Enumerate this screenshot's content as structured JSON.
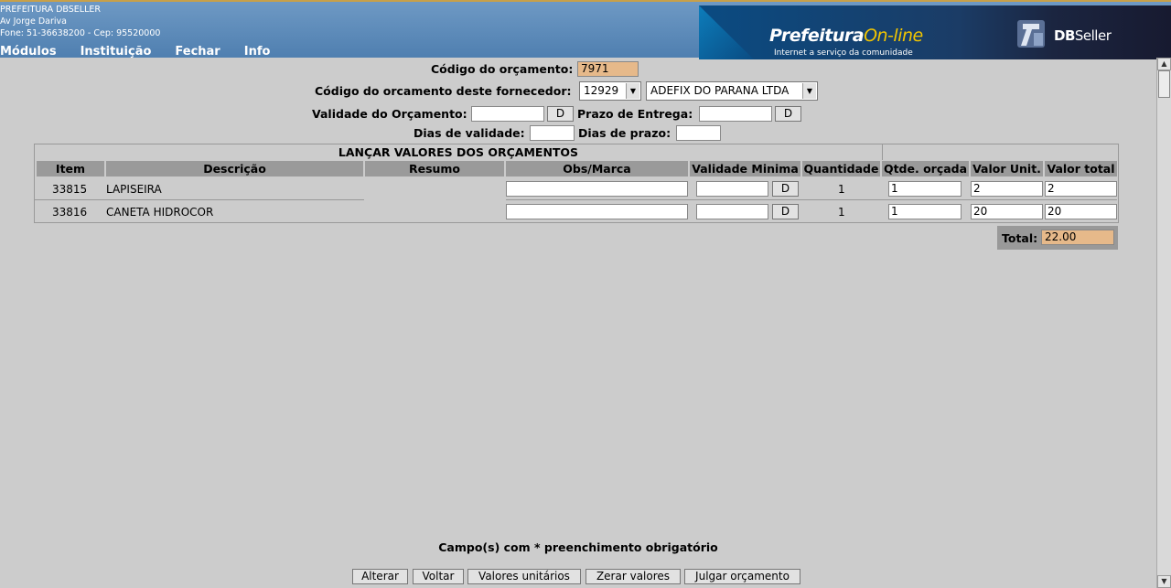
{
  "header": {
    "org_name": "PREFEITURA DBSELLER",
    "address": "Av Jorge Dariva",
    "phone_line": "Fone: 51-36638200  -  Cep: 95520000",
    "menu": [
      "Módulos",
      "Instituição",
      "Fechar",
      "Info"
    ],
    "banner": {
      "brand_part1": "Prefeitura",
      "brand_part2": "On-line",
      "tagline": "Internet a serviço da comunidade",
      "vendor_part1": "DB",
      "vendor_part2": "Seller"
    }
  },
  "form": {
    "codigo_orcamento_label": "Código do orçamento:",
    "codigo_orcamento_value": "7971",
    "codigo_fornecedor_label": "Código do orcamento deste fornecedor:",
    "fornecedor_code": "12929",
    "fornecedor_name": "ADEFIX DO PARANA LTDA",
    "validade_label": "Validade do Orçamento:",
    "validade_value": "",
    "prazo_label": "Prazo de Entrega:",
    "prazo_value": "",
    "dias_validade_label": "Dias de validade:",
    "dias_validade_value": "",
    "dias_prazo_label": "Dias de prazo:",
    "dias_prazo_value": "",
    "date_button": "D"
  },
  "table": {
    "title": "LANÇAR VALORES DOS ORÇAMENTOS",
    "columns": [
      "Item",
      "Descrição",
      "Resumo",
      "Obs/Marca",
      "Validade Minima",
      "Quantidade",
      "Qtde. orçada",
      "Valor Unit.",
      "Valor total"
    ],
    "rows": [
      {
        "item": "33815",
        "descricao": "LAPISEIRA",
        "resumo": "",
        "obs": "",
        "validade": "",
        "quantidade": "1",
        "qtde_orcada": "1",
        "valor_unit": "2",
        "valor_total": "2"
      },
      {
        "item": "33816",
        "descricao": "CANETA HIDROCOR",
        "resumo": "",
        "obs": "",
        "validade": "",
        "quantidade": "1",
        "qtde_orcada": "1",
        "valor_unit": "20",
        "valor_total": "20"
      }
    ],
    "total_label": "Total:",
    "total_value": "22.00"
  },
  "footer": {
    "note": "Campo(s) com * preenchimento obrigatório",
    "buttons": [
      "Alterar",
      "Voltar",
      "Valores unitários",
      "Zerar valores",
      "Julgar orçamento"
    ]
  }
}
